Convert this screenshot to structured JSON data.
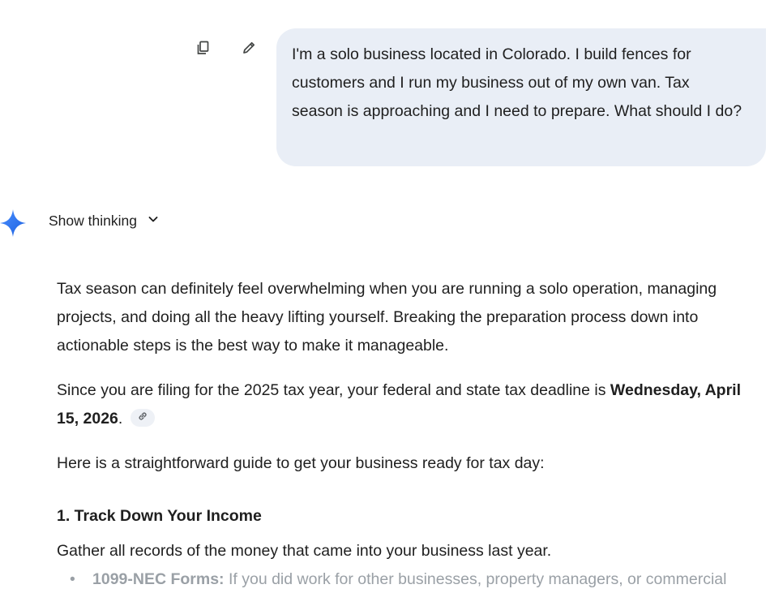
{
  "user_message": {
    "text": "I'm a solo business located in Colorado. I build fences for customers and I run my business out of my own van. Tax season is approaching and I need to prepare. What should I do?"
  },
  "message_actions": {
    "copy_icon": "copy-icon",
    "edit_icon": "pencil-icon"
  },
  "gemini": {
    "spark_icon": "gemini-spark-icon",
    "spark_color": "#4285f4",
    "show_thinking_label": "Show thinking",
    "chevron_icon": "chevron-down-icon"
  },
  "response": {
    "p1": "Tax season can definitely feel overwhelming when you are running a solo operation, managing projects, and doing all the heavy lifting yourself. Breaking the preparation process down into actionable steps is the best way to make it manageable.",
    "p2_before": "Since you are filing for the 2025 tax year, your federal and state tax deadline is ",
    "p2_bold": "Wednesday, April 15, 2026",
    "p2_after": ".",
    "citation_icon": "link-icon",
    "p3": "Here is a straightforward guide to get your business ready for tax day:",
    "section1_heading": "1. Track Down Your Income",
    "section1_intro": "Gather all records of the money that came into your business last year.",
    "bullets": [
      {
        "bullet": "•",
        "bold": "1099-NEC Forms:",
        "text": " If you did work for other businesses, property managers, or commercial"
      }
    ]
  }
}
